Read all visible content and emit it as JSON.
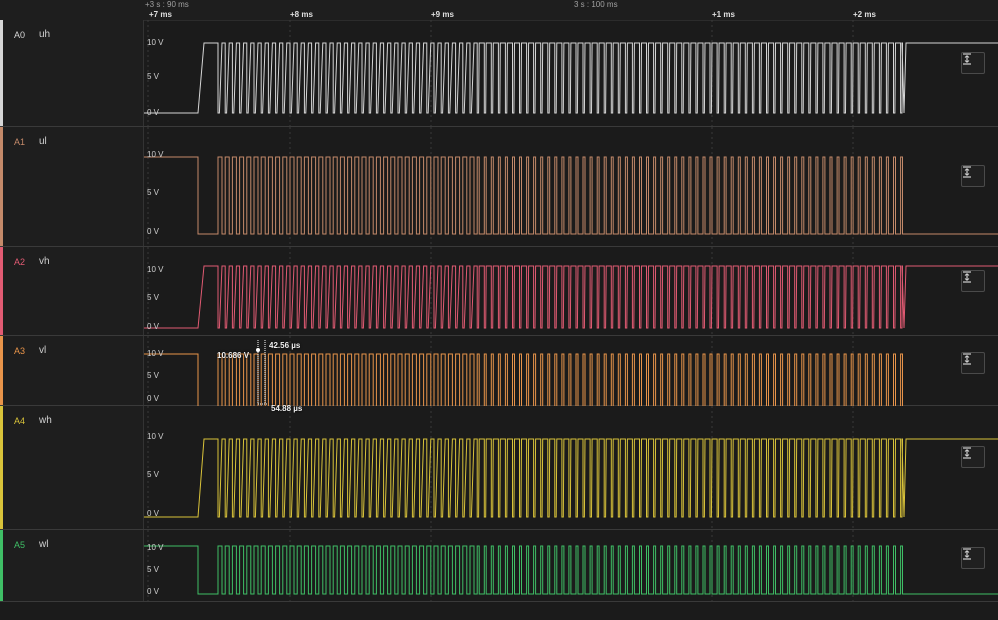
{
  "ruler": {
    "group_labels": [
      "+3 s : 90 ms",
      "3 s : 100 ms"
    ],
    "tick_labels": [
      "+7 ms",
      "+8 ms",
      "+9 ms",
      "+1 ms",
      "+2 ms"
    ]
  },
  "channels": [
    {
      "id": "A0",
      "name": "uh",
      "color": "#d6d6d6",
      "y_labels": [
        "10 V",
        "5 V",
        "0 V"
      ]
    },
    {
      "id": "A1",
      "name": "ul",
      "color": "#c48a6a",
      "y_labels": [
        "10 V",
        "5 V",
        "0 V"
      ]
    },
    {
      "id": "A2",
      "name": "vh",
      "color": "#e25b73",
      "y_labels": [
        "10 V",
        "5 V",
        "0 V"
      ]
    },
    {
      "id": "A3",
      "name": "vl",
      "color": "#e8944a",
      "y_labels": [
        "10 V",
        "5 V",
        "0 V"
      ]
    },
    {
      "id": "A4",
      "name": "wh",
      "color": "#d9c33a",
      "y_labels": [
        "10 V",
        "5 V",
        "0 V"
      ]
    },
    {
      "id": "A5",
      "name": "wl",
      "color": "#3fbf66",
      "y_labels": [
        "10 V",
        "5 V",
        "0 V"
      ]
    }
  ],
  "measurement": {
    "voltage": "10.686 V",
    "pulse_width": "42.56 µs",
    "period": "54.88 µs"
  },
  "icons": {
    "scale": "vertical-fit-icon"
  }
}
